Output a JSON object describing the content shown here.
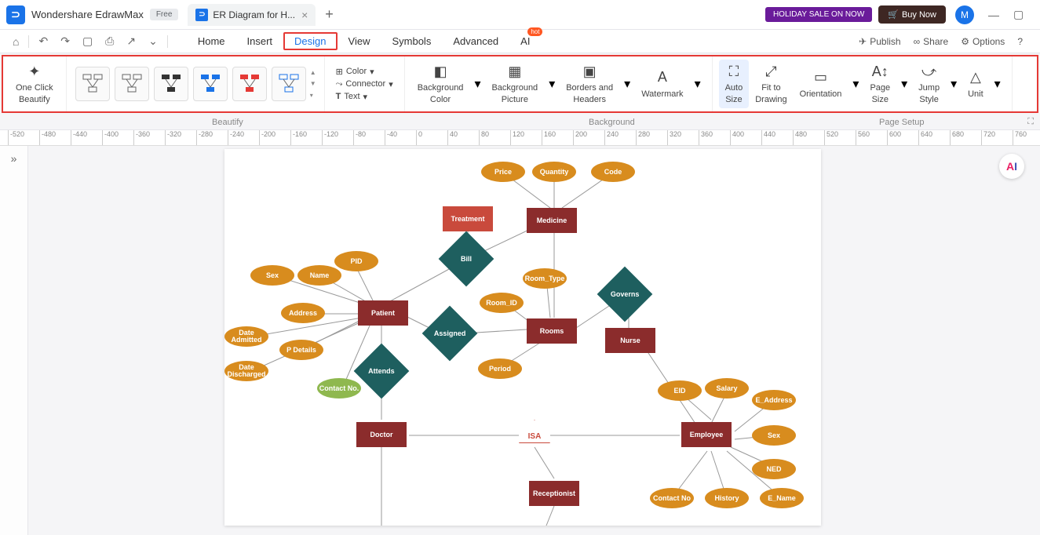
{
  "titlebar": {
    "app_name": "Wondershare EdrawMax",
    "free_badge": "Free",
    "tab_title": "ER Diagram for H...",
    "holiday_btn": "HOLIDAY SALE ON NOW",
    "buy_btn": "Buy Now",
    "avatar_initial": "M"
  },
  "menubar": {
    "items": [
      "Home",
      "Insert",
      "Design",
      "View",
      "Symbols",
      "Advanced",
      "AI"
    ],
    "hot_label": "hot",
    "right": {
      "publish": "Publish",
      "share": "Share",
      "options": "Options"
    }
  },
  "ribbon": {
    "beautify_btn": "One Click\nBeautify",
    "color": "Color",
    "connector": "Connector",
    "text": "Text",
    "bg_color": "Background\nColor",
    "bg_picture": "Background\nPicture",
    "borders": "Borders and\nHeaders",
    "watermark": "Watermark",
    "auto_size": "Auto\nSize",
    "fit_drawing": "Fit to\nDrawing",
    "orientation": "Orientation",
    "page_size": "Page\nSize",
    "jump_style": "Jump\nStyle",
    "unit": "Unit"
  },
  "sections": {
    "beautify": "Beautify",
    "background": "Background",
    "page_setup": "Page Setup"
  },
  "ruler_ticks": [
    "-520",
    "-480",
    "-440",
    "-400",
    "-360",
    "-320",
    "-280",
    "-240",
    "-200",
    "-160",
    "-120",
    "-80",
    "-40",
    "0",
    "40",
    "80",
    "120",
    "160",
    "200",
    "240",
    "280",
    "320",
    "360",
    "400",
    "440",
    "480",
    "520",
    "560",
    "600",
    "640",
    "680",
    "720",
    "760"
  ],
  "diagram": {
    "entities": {
      "treatment": "Treatment",
      "medicine": "Medicine",
      "patient": "Patient",
      "rooms": "Rooms",
      "nurse": "Nurse",
      "doctor": "Doctor",
      "employee": "Employee",
      "receptionist": "Receptionist"
    },
    "relationships": {
      "bill": "Bill",
      "governs": "Governs",
      "assigned": "Assigned",
      "attends": "Attends",
      "isa": "ISA"
    },
    "attributes": {
      "price": "Price",
      "quantity": "Quantity",
      "code": "Code",
      "pid": "PID",
      "sex": "Sex",
      "name": "Name",
      "address": "Address",
      "date_admitted": "Date\nAdmitted",
      "p_details": "P Details",
      "date_discharged": "Date\nDischarged",
      "contact_no": "Contact No.",
      "room_type": "Room_Type",
      "room_id": "Room_ID",
      "period": "Period",
      "eid": "EID",
      "salary": "Salary",
      "e_address": "E_Address",
      "emp_sex": "Sex",
      "ned": "NED",
      "emp_contact": "Contact No",
      "history": "History",
      "e_name": "E_Name"
    }
  }
}
